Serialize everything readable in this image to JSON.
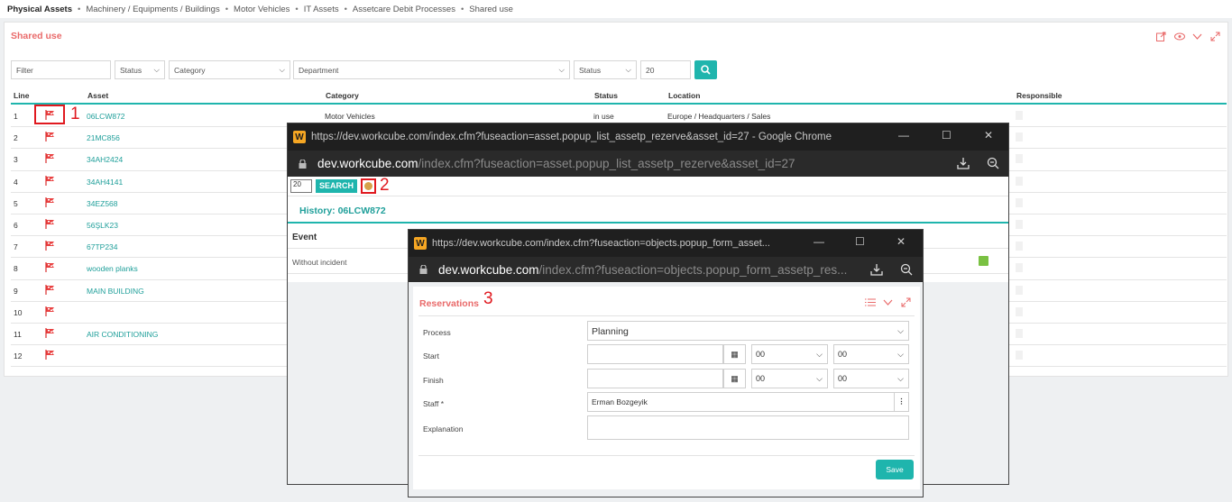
{
  "breadcrumb": [
    "Physical Assets",
    "Machinery / Equipments / Buildings",
    "Motor Vehicles",
    "IT Assets",
    "Assetcare Debit Processes",
    "Shared use"
  ],
  "panel": {
    "title": "Shared use",
    "filters": {
      "filter_placeholder": "Filter",
      "status1": "Status",
      "category": "Category",
      "department": "Department",
      "status2": "Status",
      "page_size": "20"
    },
    "columns": [
      "Line",
      "Asset",
      "Category",
      "Status",
      "Location",
      "Responsible"
    ],
    "rows": [
      {
        "line": "1",
        "asset": "06LCW872",
        "category": "Motor Vehicles",
        "status": "in use",
        "location": "Europe / Headquarters / Sales"
      },
      {
        "line": "2",
        "asset": "21MC856",
        "category": "",
        "status": "",
        "location": ""
      },
      {
        "line": "3",
        "asset": "34AH2424",
        "category": "",
        "status": "",
        "location": ""
      },
      {
        "line": "4",
        "asset": "34AH4141",
        "category": "",
        "status": "",
        "location": ""
      },
      {
        "line": "5",
        "asset": "34EZ568",
        "category": "",
        "status": "",
        "location": ""
      },
      {
        "line": "6",
        "asset": "56ŞLK23",
        "category": "",
        "status": "",
        "location": ""
      },
      {
        "line": "7",
        "asset": "67TP234",
        "category": "",
        "status": "",
        "location": ""
      },
      {
        "line": "8",
        "asset": "wooden planks",
        "category": "",
        "status": "",
        "location": ""
      },
      {
        "line": "9",
        "asset": "MAIN BUILDING",
        "category": "",
        "status": "",
        "location": ""
      },
      {
        "line": "10",
        "asset": "",
        "category": "",
        "status": "",
        "location": ""
      },
      {
        "line": "11",
        "asset": "AIR CONDITIONING",
        "category": "",
        "status": "",
        "location": ""
      },
      {
        "line": "12",
        "asset": "",
        "category": "",
        "status": "",
        "location": ""
      }
    ]
  },
  "annotations": {
    "n1": "1",
    "n2": "2",
    "n3": "3"
  },
  "popup1": {
    "title": "https://dev.workcube.com/index.cfm?fuseaction=asset.popup_list_assetp_rezerve&asset_id=27 - Google Chrome",
    "url_domain": "dev.workcube.com",
    "url_path": "/index.cfm?fuseaction=asset.popup_list_assetp_rezerve&asset_id=27",
    "page_size": "20",
    "search_label": "SEARCH",
    "history_title": "History: 06LCW872",
    "event_header": "Event",
    "event_row": "Without incident"
  },
  "popup2": {
    "title": "https://dev.workcube.com/index.cfm?fuseaction=objects.popup_form_asset...",
    "url_domain": "dev.workcube.com",
    "url_path": "/index.cfm?fuseaction=objects.popup_form_assetp_res...",
    "form_title": "Reservations",
    "labels": {
      "process": "Process",
      "start": "Start",
      "finish": "Finish",
      "staff": "Staff *",
      "explanation": "Explanation"
    },
    "process_value": "Planning",
    "start_hour": "00",
    "start_min": "00",
    "finish_hour": "00",
    "finish_min": "00",
    "staff_value": "Erman Bozgeyik",
    "save_label": "Save"
  },
  "colors": {
    "accent": "#1fb5ad",
    "title": "#e96a6a",
    "annotation": "#e0191f"
  }
}
